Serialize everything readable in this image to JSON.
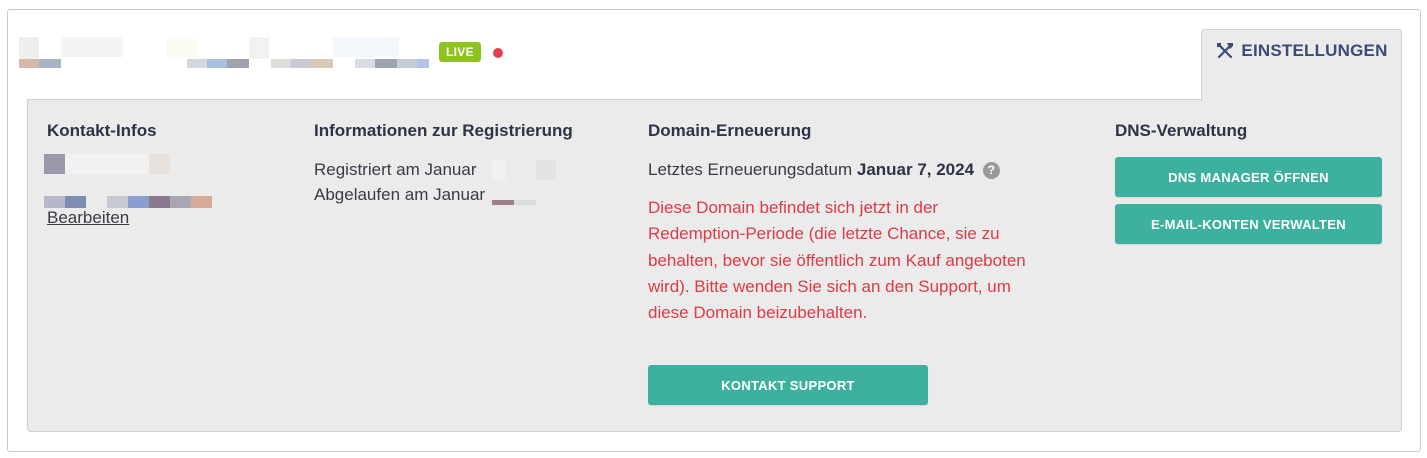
{
  "header": {
    "live_badge": "LIVE",
    "status_dot_color": "#e0414d",
    "settings_tab_label": "EINSTELLUNGEN",
    "settings_icon": "tools-icon"
  },
  "contact": {
    "title": "Kontakt-Infos",
    "edit_link": "Bearbeiten"
  },
  "registration": {
    "title": "Informationen zur Registrierung",
    "registered_label": "Registriert am Januar",
    "expired_label": "Abgelaufen am Januar"
  },
  "renewal": {
    "title": "Domain-Erneuerung",
    "last_renewal_label": "Letztes Erneuerungsdatum",
    "last_renewal_date": "Januar 7, 2024",
    "help_icon_glyph": "?",
    "warning_text": "Diese Domain befindet sich jetzt in der Redemption-Periode (die letzte Chance, sie zu behalten, bevor sie öffentlich zum Kauf angeboten wird). Bitte wenden Sie sich an den Support, um diese Domain beizubehalten.",
    "contact_support_button": "KONTAKT SUPPORT"
  },
  "dns": {
    "title": "DNS-Verwaltung",
    "open_dns_manager_button": "DNS MANAGER ÖFFNEN",
    "manage_email_button": "E-MAIL-KONTEN VERWALTEN"
  },
  "colors": {
    "accent": "#3eb19e",
    "live": "#8ec31f",
    "warning": "#df3a45",
    "tab_text": "#3d4a78"
  }
}
